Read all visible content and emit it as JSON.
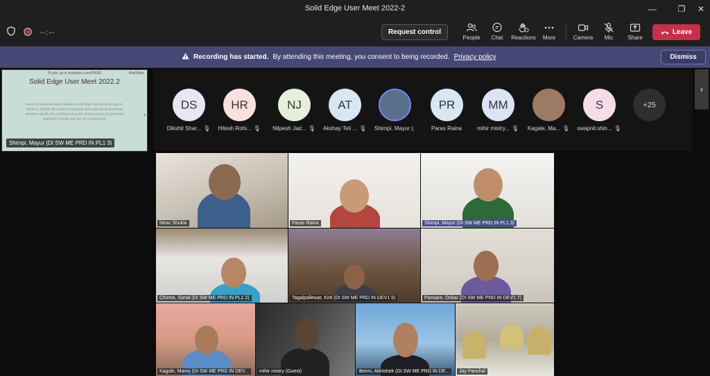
{
  "window": {
    "title": "Solid Edge User Meet 2022-2",
    "minimize_glyph": "—",
    "maximize_glyph": "❐",
    "close_glyph": "✕"
  },
  "toolbar": {
    "timer": "--:--",
    "request_control_label": "Request control",
    "items": [
      {
        "label": "People",
        "icon": "people-icon"
      },
      {
        "label": "Chat",
        "icon": "chat-icon"
      },
      {
        "label": "Reactions",
        "icon": "reactions-icon"
      },
      {
        "label": "More",
        "icon": "more-icon"
      },
      {
        "label": "Camera",
        "icon": "camera-icon"
      },
      {
        "label": "Mic",
        "icon": "mic-off-icon"
      },
      {
        "label": "Share",
        "icon": "share-icon"
      }
    ],
    "leave_label": "Leave",
    "leave_color": "#c4314b"
  },
  "banner": {
    "title": "Recording has started.",
    "message": "By attending this meeting, you consent to being recorded.",
    "link": "Privacy policy",
    "dismiss_label": "Dismiss",
    "background": "#464775"
  },
  "share": {
    "top_text": "To join, go to ahaslides.com/P8082",
    "brand": "AhaSlides",
    "title": "Solid Edge User Meet 2022.2",
    "body": "Guess the word/command related to Solid Edge from the given options. Section1: Identify the command using the given pictorial (6 Questions) Section2: Identify the command using the command icon (5 Questions) Bothered: Find the odd one out (2 Questions)",
    "presenter": "Shimpi, Mayur (DI SW ME PRD IN PL1 3)"
  },
  "roster": {
    "participants": [
      {
        "initials": "DS",
        "name": "Dikshit Shar...",
        "color": "#e9e5f5"
      },
      {
        "initials": "HR",
        "name": "Hitesh Rohi...",
        "color": "#f8e1dc"
      },
      {
        "initials": "NJ",
        "name": "Nilpesh Jad...",
        "color": "#e6f0d8"
      },
      {
        "initials": "AT",
        "name": "Akshay Teli ...",
        "color": "#d9e6f3"
      },
      {
        "initials": "",
        "name": "Shimpi, Mayur (...",
        "color": "#5a6f8c"
      },
      {
        "initials": "PR",
        "name": "Paras Raina",
        "color": "#d9e6f3"
      },
      {
        "initials": "MM",
        "name": "mihir mistry...",
        "color": "#dce3f2"
      },
      {
        "initials": "",
        "name": "Kagale, Ma...",
        "color": "#9c7a63"
      },
      {
        "initials": "S",
        "name": "swapnil.shin...",
        "color": "#f4dde8"
      }
    ],
    "more_count": "+25"
  },
  "videos": [
    {
      "name": "Nirav Shukla",
      "active": false
    },
    {
      "name": "Paras Raina",
      "active": false
    },
    {
      "name": "Shimpi, Mayur (DI SW ME PRD IN PL1 3)",
      "active": true
    },
    {
      "name": "Chirme, Sonal (DI SW ME PRD IN PL1 2)",
      "active": false
    },
    {
      "name": "Tagalpallewar, Kirti (DI SW ME PRD IN DEV1 5)",
      "active": false
    },
    {
      "name": "Pansare, Onkar (DI SW ME PRD IN DEV1 7)",
      "active": false
    },
    {
      "name": "Kagale, Manoj (DI SW ME PRD IN DEV...",
      "active": false
    },
    {
      "name": "mihir mistry (Guest)",
      "active": false
    },
    {
      "name": "Benni, Abhishek (DI SW ME PRD IN DE...",
      "active": false
    },
    {
      "name": "Jay Panchal",
      "active": false
    }
  ]
}
